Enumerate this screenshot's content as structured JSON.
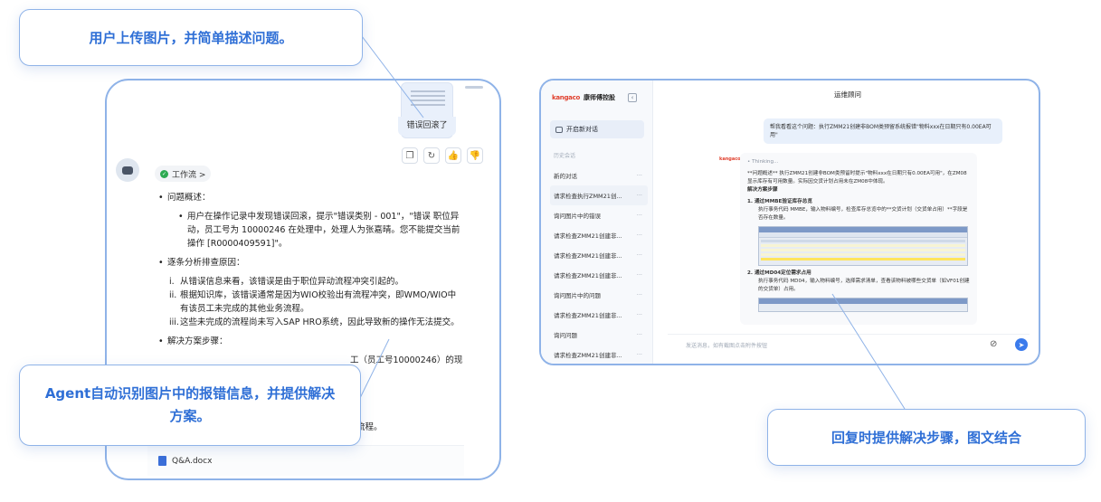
{
  "callouts": {
    "upload": "用户上传图片，并简单描述问题。",
    "agent": "Agent自动识别图片中的报错信息，并提供解决方案。",
    "reply": "回复时提供解决步骤，图文结合"
  },
  "left_panel": {
    "thumbnail_caption": "错误回滚了",
    "workflow_label": "工作流 >",
    "answer": {
      "section1_title": "问题概述：",
      "section1_body": "用户在操作记录中发现错误回滚，提示\"错误类别 - 001\"，\"错误 职位异动，员工号为 10000246 在处理中，处理人为张嘉晴。您不能提交当前操作 [R0000409591]\"。",
      "section2_title": "逐条分析排查原因：",
      "section2_items": [
        {
          "num": "i.",
          "text": "从错误信息来看，该错误是由于职位异动流程冲突引起的。"
        },
        {
          "num": "ii.",
          "text": "根据知识库，该错误通常是因为WIO校验出有流程冲突，即WMO/WIO中有该员工未完成的其他业务流程。"
        },
        {
          "num": "iii.",
          "text": "这些未完成的流程尚未写入SAP HRO系统，因此导致新的操作无法提交。"
        }
      ],
      "section3_title": "解决方案步骤：",
      "section3_partial": "工（员工号10000246）的现",
      "tail_fragment": "流程。"
    },
    "attachment": "Q&A.docx"
  },
  "right_panel": {
    "brand_logo": "kangaco",
    "brand_name": "康师傅控股",
    "new_chat": "开启新对话",
    "history_label": "历史会话",
    "history": [
      "新的对话",
      "请求检查执行ZMM21创...",
      "询问图片中的错误",
      "请求检查ZMM21创建非...",
      "请求检查ZMM21创建非...",
      "请求检查ZMM21创建非...",
      "询问图片中的问题",
      "请求检查ZMM21创建非...",
      "询问问题",
      "请求检查ZMM21创建非..."
    ],
    "history_more": "···",
    "chat_title": "运维顾问",
    "user_message": "帮我看看这个问题：执行ZMM21创建非BOM类预留系统报错\"物料xxx在日期只有0.00EA可用\"",
    "thinking": "• Thinking...",
    "bot_intro": "**问题概述** 执行ZMM21创建非BOM类预留时提示\"物料xxx在日期只有0.00EA可用\"，在ZM08显示库存有可用数量。实际因交货计划占用未在ZM08中体现。",
    "solution_title": "解决方案步骤",
    "step1_title": "1. 通过MMBE验证库存总览",
    "step1_desc": "执行事务代码 MMBE，输入物料编号，检查库存总览中的**交货计划（交货单占用）**字段是否存在数量。",
    "step2_title": "2. 通过MD04定位需求占用",
    "step2_desc": "执行事务代码 MD04，输入物料编号，选择需求清单，查看该物料被哪些交货单（如VF01创建的交货单）占用。",
    "input_placeholder": "发送消息，如有截图点击附件按钮"
  }
}
